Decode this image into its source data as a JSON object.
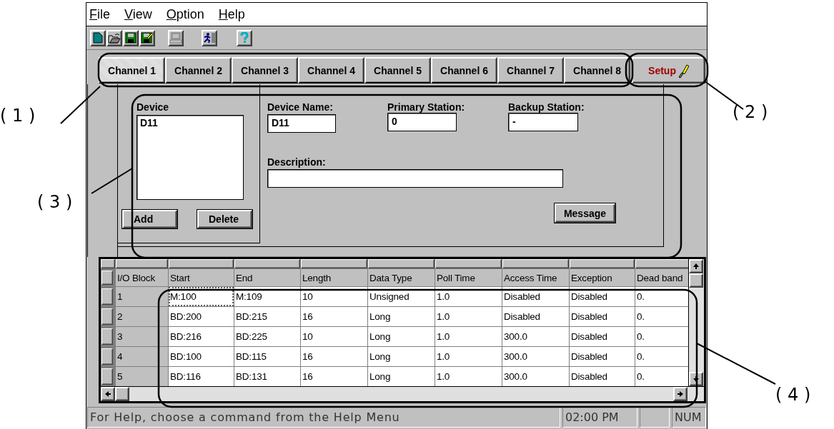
{
  "menu": [
    {
      "label": "File"
    },
    {
      "label": "View"
    },
    {
      "label": "Option"
    },
    {
      "label": "Help"
    }
  ],
  "toolbar": [
    {
      "kind": "new",
      "disabled": false
    },
    {
      "kind": "open",
      "disabled": false
    },
    {
      "kind": "save",
      "disabled": false
    },
    {
      "kind": "save-edit",
      "disabled": false
    },
    {
      "kind": "computer",
      "disabled": true
    },
    {
      "kind": "run",
      "disabled": false
    },
    {
      "kind": "help",
      "disabled": false
    }
  ],
  "tabs": [
    {
      "label": "Channel 1",
      "selected": true
    },
    {
      "label": "Channel 2",
      "selected": false
    },
    {
      "label": "Channel 3",
      "selected": false
    },
    {
      "label": "Channel 4",
      "selected": false
    },
    {
      "label": "Channel 5",
      "selected": false
    },
    {
      "label": "Channel 6",
      "selected": false
    },
    {
      "label": "Channel 7",
      "selected": false
    },
    {
      "label": "Channel 8",
      "selected": false
    }
  ],
  "setup_button": {
    "label": "Setup"
  },
  "device": {
    "title": "Device",
    "items": [
      "D11"
    ],
    "buttons": [
      "Add",
      "Delete"
    ]
  },
  "fields": [
    {
      "label": "Device Name:",
      "value": "D11"
    },
    {
      "label": "Primary Station:",
      "value": "0"
    },
    {
      "label": "Backup Station:",
      "value": "-"
    },
    {
      "label": "Description:"
    }
  ],
  "message_button": {
    "label": "Message"
  },
  "grid": {
    "columns": [
      "I/O Block",
      "Start",
      "End",
      "Length",
      "Data Type",
      "Poll Time",
      "Access Time",
      "Exception",
      "Dead band"
    ],
    "rows": [
      {
        "current": true,
        "cells": [
          "1",
          "M:100",
          "M:109",
          "10",
          "Unsigned",
          "1.0",
          "Disabled",
          "Disabled",
          "0."
        ]
      },
      {
        "current": false,
        "cells": [
          "2",
          "BD:200",
          "BD:215",
          "16",
          "Long",
          "1.0",
          "Disabled",
          "Disabled",
          "0."
        ]
      },
      {
        "current": false,
        "cells": [
          "3",
          "BD:216",
          "BD:225",
          "10",
          "Long",
          "1.0",
          "300.0",
          "Disabled",
          "0."
        ]
      },
      {
        "current": false,
        "cells": [
          "4",
          "BD:100",
          "BD:115",
          "16",
          "Long",
          "1.0",
          "300.0",
          "Disabled",
          "0."
        ]
      },
      {
        "current": false,
        "cells": [
          "5",
          "BD:116",
          "BD:131",
          "16",
          "Long",
          "1.0",
          "300.0",
          "Disabled",
          "0."
        ]
      }
    ]
  },
  "status_bar": {
    "message": "For Help, choose a command from the Help Menu",
    "time": "02:00 PM",
    "indicator": "NUM"
  },
  "callouts": [
    {
      "label": "( 1 )"
    },
    {
      "label": "( 2 )"
    },
    {
      "label": "( 3 )"
    },
    {
      "label": "( 4 )"
    }
  ]
}
